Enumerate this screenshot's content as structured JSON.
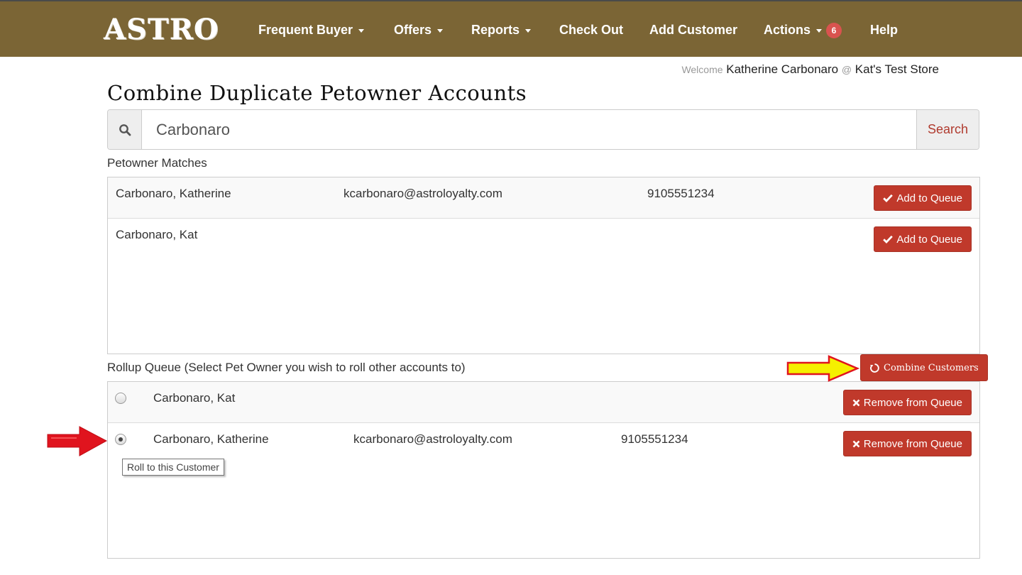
{
  "navbar": {
    "logo": "ASTRO",
    "items": [
      {
        "label": "Frequent Buyer",
        "dropdown": true
      },
      {
        "label": "Offers",
        "dropdown": true
      },
      {
        "label": "Reports",
        "dropdown": true
      },
      {
        "label": "Check Out",
        "dropdown": false
      },
      {
        "label": "Add Customer",
        "dropdown": false
      },
      {
        "label": "Actions",
        "dropdown": true,
        "badge": "6"
      },
      {
        "label": "Help",
        "dropdown": false
      }
    ],
    "background_color": "#7b6535"
  },
  "welcome": {
    "prefix": "Welcome",
    "user": "Katherine Carbonaro",
    "at": "@",
    "store": "Kat's Test Store"
  },
  "page_title": "Combine Duplicate Petowner Accounts",
  "search": {
    "value": "Carbonaro",
    "button_label": "Search",
    "icon": "search-icon"
  },
  "matches": {
    "label": "Petowner Matches",
    "button_label": "Add to Queue",
    "button_icon": "check-icon",
    "rows": [
      {
        "name": "Carbonaro, Katherine",
        "email": "kcarbonaro@astroloyalty.com",
        "phone": "9105551234"
      },
      {
        "name": "Carbonaro, Kat",
        "email": "",
        "phone": ""
      }
    ]
  },
  "queue": {
    "label": "Rollup Queue (Select Pet Owner you wish to roll other accounts to)",
    "combine_button_label": "Combine Customers",
    "combine_button_icon": "recycle-icon",
    "remove_button_label": "Remove from Queue",
    "remove_button_icon": "times-icon",
    "rows": [
      {
        "name": "Carbonaro, Kat",
        "email": "",
        "phone": "",
        "selected": false
      },
      {
        "name": "Carbonaro, Katherine",
        "email": "kcarbonaro@astroloyalty.com",
        "phone": "9105551234",
        "selected": true
      }
    ],
    "tooltip": "Roll to this Customer"
  },
  "colors": {
    "accent_red": "#c0392b",
    "annotation_yellow": "#f5f000",
    "annotation_red": "#e0141e"
  }
}
